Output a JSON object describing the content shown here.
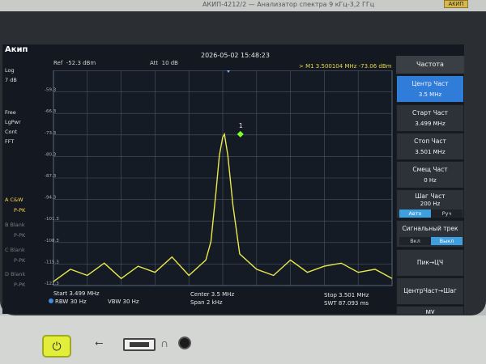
{
  "device": {
    "model_text": "АКИП-4212/2 — Анализатор спектра 9 кГц-3,2 ГГц",
    "badge": "АКИП"
  },
  "header": {
    "logo": "Акип",
    "datetime": "2026-05-02 15:48:23",
    "ref_label": "Ref",
    "ref_value": "-52.3 dBm",
    "att_label": "Att",
    "att_value": "10 dB",
    "marker_readout": "> M1  3.500104 MHz  -73.06 dBm"
  },
  "left_panel": {
    "log": "Log",
    "scale": "7 dB",
    "free": "Free",
    "lgpwr": "LgPwr",
    "cont": "Cont",
    "fft": "FFT",
    "trace_a": "A  C&W",
    "trace_a_det": "P-PK",
    "trace_b": "B  Blank",
    "trace_b_det": "P-PK",
    "trace_c": "C  Blank",
    "trace_c_det": "P-PK",
    "trace_d": "D  Blank",
    "trace_d_det": "P-PK"
  },
  "y_ticks": [
    "-59.3",
    "-66.3",
    "-73.3",
    "-80.3",
    "-87.3",
    "-94.3",
    "-101.3",
    "-108.3",
    "-115.3",
    "-122.3"
  ],
  "marker": {
    "label": "1",
    "freq_mhz": 3.500104,
    "level_dbm": -73.06
  },
  "bottom": {
    "start": "Start  3.499 MHz",
    "rbw": "RBW  30 Hz",
    "vbw": "VBW  30 Hz",
    "center": "Center  3.5 MHz",
    "span": "Span    2 kHz",
    "stop": "Stop  3.501 MHz",
    "swt": "SWT  87.093 ms"
  },
  "menu": {
    "title": "Частота",
    "center_label": "Центр Част",
    "center_value": "3.5 MHz",
    "start_label": "Старт Част",
    "start_value": "3.499 MHz",
    "stop_label": "Стоп Част",
    "stop_value": "3.501 MHz",
    "offset_label": "Смещ Част",
    "offset_value": "0 Hz",
    "step_label": "Шаг Част",
    "step_value": "200 Hz",
    "step_auto": "Авто",
    "step_manual": "Руч",
    "signal_track_label": "Сигнальный трек",
    "track_on": "Вкл",
    "track_off": "Выкл",
    "peak_to_cf": "Пик→ЦЧ",
    "cf_to_step": "ЦентрЧаст→Шаг",
    "more": "МУ"
  },
  "colors": {
    "trace": "#e9e94a",
    "grid": "#4a5566",
    "accent": "#2f7dd8",
    "marker": "#7cff2a"
  },
  "chart_data": {
    "type": "line",
    "x_unit": "MHz",
    "xlim": [
      3.499,
      3.501
    ],
    "ylim": [
      -122.3,
      -52.3
    ],
    "grid": true,
    "series": [
      {
        "x": [
          3.499,
          3.4991,
          3.4992,
          3.4993,
          3.4994,
          3.4995,
          3.4996,
          3.4997,
          3.4998,
          3.4999,
          3.49993,
          3.49996,
          3.49998,
          3.5,
          3.50001,
          3.50003,
          3.50006,
          3.5001,
          3.5002,
          3.5003,
          3.5004,
          3.5005,
          3.5006,
          3.5007,
          3.5008,
          3.5009,
          3.501
        ],
        "values": [
          -121,
          -117,
          -119,
          -115,
          -120,
          -116,
          -118,
          -113,
          -119,
          -114,
          -108,
          -92,
          -80,
          -74,
          -73.06,
          -80,
          -96,
          -112,
          -117,
          -119,
          -114,
          -118,
          -116,
          -115,
          -118,
          -117,
          -120
        ]
      }
    ]
  }
}
